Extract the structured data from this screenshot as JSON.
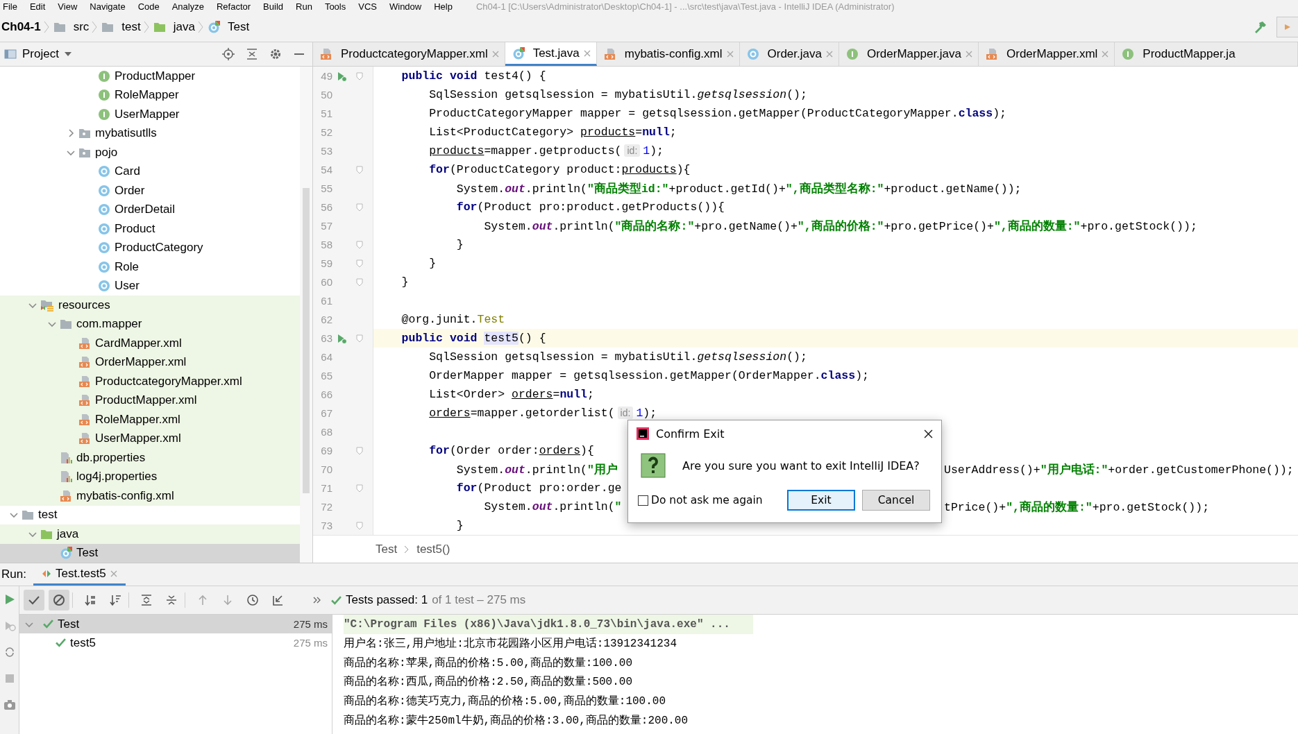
{
  "menu": [
    "File",
    "Edit",
    "View",
    "Navigate",
    "Code",
    "Analyze",
    "Refactor",
    "Build",
    "Run",
    "Tools",
    "VCS",
    "Window",
    "Help"
  ],
  "window_title": "Ch04-1 [C:\\Users\\Administrator\\Desktop\\Ch04-1] - ...\\src\\test\\java\\Test.java - IntelliJ IDEA (Administrator)",
  "breadcrumbs": [
    {
      "label": "Ch04-1",
      "kind": "project"
    },
    {
      "label": "src",
      "kind": "folder"
    },
    {
      "label": "test",
      "kind": "folder"
    },
    {
      "label": "java",
      "kind": "source_folder"
    },
    {
      "label": "Test",
      "kind": "testclass"
    }
  ],
  "project_panel": {
    "title": "Project"
  },
  "tabs": [
    {
      "label": "ProductcategoryMapper.xml",
      "kind": "xml",
      "selected": false,
      "closable": true
    },
    {
      "label": "Test.java",
      "kind": "testclass",
      "selected": true,
      "closable": true
    },
    {
      "label": "mybatis-config.xml",
      "kind": "xml",
      "selected": false,
      "closable": true
    },
    {
      "label": "Order.java",
      "kind": "class",
      "selected": false,
      "closable": true
    },
    {
      "label": "OrderMapper.java",
      "kind": "interface",
      "selected": false,
      "closable": true
    },
    {
      "label": "OrderMapper.xml",
      "kind": "xml",
      "selected": false,
      "closable": true
    },
    {
      "label": "ProductMapper.ja",
      "kind": "interface",
      "selected": false,
      "closable": false
    }
  ],
  "tree": [
    {
      "children": [
        {
          "children": [
            {
              "children": [
                {
                  "children": [
                    {
                      "label": "ProductMapper",
                      "kind": "interface",
                      "selected": false
                    },
                    {
                      "label": "RoleMapper",
                      "kind": "interface",
                      "selected": false
                    },
                    {
                      "label": "UserMapper",
                      "kind": "interface",
                      "selected": false
                    }
                  ]
                },
                {
                  "label": "mybatisutlls",
                  "kind": "package",
                  "expanded": false,
                  "selected": false
                },
                {
                  "label": "pojo",
                  "kind": "package",
                  "expanded": true,
                  "selected": false,
                  "children": [
                    {
                      "label": "Card",
                      "kind": "class",
                      "selected": false
                    },
                    {
                      "label": "Order",
                      "kind": "class",
                      "selected": false
                    },
                    {
                      "label": "OrderDetail",
                      "kind": "class",
                      "selected": false
                    },
                    {
                      "label": "Product",
                      "kind": "class",
                      "selected": false
                    },
                    {
                      "label": "ProductCategory",
                      "kind": "class",
                      "selected": false
                    },
                    {
                      "label": "Role",
                      "kind": "class",
                      "selected": false
                    },
                    {
                      "label": "User",
                      "kind": "class",
                      "selected": false
                    }
                  ]
                }
              ]
            }
          ]
        },
        {
          "label": "resources",
          "kind": "resources_root",
          "expanded": true,
          "selected": false,
          "children": [
            {
              "label": "com.mapper",
              "kind": "folder",
              "expanded": true,
              "selected": false,
              "children": [
                {
                  "label": "CardMapper.xml",
                  "kind": "xml",
                  "selected": false
                },
                {
                  "label": "OrderMapper.xml",
                  "kind": "xml",
                  "selected": false
                },
                {
                  "label": "ProductcategoryMapper.xml",
                  "kind": "xml",
                  "selected": false
                },
                {
                  "label": "ProductMapper.xml",
                  "kind": "xml",
                  "selected": false
                },
                {
                  "label": "RoleMapper.xml",
                  "kind": "xml",
                  "selected": false
                },
                {
                  "label": "UserMapper.xml",
                  "kind": "xml",
                  "selected": false
                }
              ]
            },
            {
              "label": "db.properties",
              "kind": "properties",
              "selected": false
            },
            {
              "label": "log4j.properties",
              "kind": "properties",
              "selected": false
            },
            {
              "label": "mybatis-config.xml",
              "kind": "xml",
              "selected": false
            }
          ]
        }
      ]
    },
    {
      "label": "test",
      "kind": "folder",
      "expanded": true,
      "selected": false,
      "children": [
        {
          "label": "java",
          "kind": "test_root",
          "expanded": true,
          "selected": false,
          "children": [
            {
              "label": "Test",
              "kind": "testclass",
              "selected": true
            }
          ]
        }
      ]
    }
  ],
  "code_lines": [
    {
      "number": "49",
      "kind": "run",
      "current": false,
      "tokens": [
        {
          "text": "    public void",
          "kind": "keyword"
        },
        {
          "text": " test4() {",
          "kind": "plain"
        }
      ]
    },
    {
      "number": "50",
      "kind": "plain",
      "current": false,
      "tokens": [
        {
          "text": "        SqlSession getsqlsession = mybatisUtil.",
          "kind": "plain"
        },
        {
          "text": "getsqlsession",
          "kind": "italic"
        },
        {
          "text": "();",
          "kind": "plain"
        }
      ]
    },
    {
      "number": "51",
      "kind": "plain",
      "current": false,
      "tokens": [
        {
          "text": "        ProductCategoryMapper mapper = getsqlsession.getMapper(ProductCategoryMapper.",
          "kind": "plain"
        },
        {
          "text": "class",
          "kind": "keyword"
        },
        {
          "text": ");",
          "kind": "plain"
        }
      ]
    },
    {
      "number": "52",
      "kind": "plain",
      "current": false,
      "tokens": [
        {
          "text": "        List<ProductCategory> ",
          "kind": "plain"
        },
        {
          "text": "products",
          "kind": "underline"
        },
        {
          "text": "=",
          "kind": "plain"
        },
        {
          "text": "null",
          "kind": "keyword"
        },
        {
          "text": ";",
          "kind": "plain"
        }
      ]
    },
    {
      "number": "53",
      "kind": "plain",
      "current": false,
      "tokens": [
        {
          "text": "        products",
          "kind": "underline"
        },
        {
          "text": "=mapper.getproducts(",
          "kind": "plain"
        },
        {
          "text": "id:",
          "kind": "hint"
        },
        {
          "text": "1",
          "kind": "number"
        },
        {
          "text": ");",
          "kind": "plain"
        }
      ]
    },
    {
      "number": "54",
      "kind": "fold",
      "current": false,
      "tokens": [
        {
          "text": "        for",
          "kind": "keyword"
        },
        {
          "text": "(ProductCategory product:",
          "kind": "plain"
        },
        {
          "text": "products",
          "kind": "underline"
        },
        {
          "text": "){",
          "kind": "plain"
        }
      ]
    },
    {
      "number": "55",
      "kind": "plain",
      "current": false,
      "tokens": [
        {
          "text": "            System.",
          "kind": "plain"
        },
        {
          "text": "out",
          "kind": "field"
        },
        {
          "text": ".println(",
          "kind": "plain"
        },
        {
          "text": "\"商品类型id:\"",
          "kind": "string"
        },
        {
          "text": "+product.getId()+",
          "kind": "plain"
        },
        {
          "text": "\",商品类型名称:\"",
          "kind": "string"
        },
        {
          "text": "+product.getName());",
          "kind": "plain"
        }
      ]
    },
    {
      "number": "56",
      "kind": "fold",
      "current": false,
      "tokens": [
        {
          "text": "            for",
          "kind": "keyword"
        },
        {
          "text": "(Product pro:product.getProducts()){",
          "kind": "plain"
        }
      ]
    },
    {
      "number": "57",
      "kind": "plain",
      "current": false,
      "tokens": [
        {
          "text": "                System.",
          "kind": "plain"
        },
        {
          "text": "out",
          "kind": "field"
        },
        {
          "text": ".println(",
          "kind": "plain"
        },
        {
          "text": "\"商品的名称:\"",
          "kind": "string"
        },
        {
          "text": "+pro.getName()+",
          "kind": "plain"
        },
        {
          "text": "\",商品的价格:\"",
          "kind": "string"
        },
        {
          "text": "+pro.getPrice()+",
          "kind": "plain"
        },
        {
          "text": "\",商品的数量:\"",
          "kind": "string"
        },
        {
          "text": "+pro.getStock());",
          "kind": "plain"
        }
      ]
    },
    {
      "number": "58",
      "kind": "fold",
      "current": false,
      "tokens": [
        {
          "text": "            }",
          "kind": "plain"
        }
      ]
    },
    {
      "number": "59",
      "kind": "fold",
      "current": false,
      "tokens": [
        {
          "text": "        }",
          "kind": "plain"
        }
      ]
    },
    {
      "number": "60",
      "kind": "fold",
      "current": false,
      "tokens": [
        {
          "text": "    }",
          "kind": "plain"
        }
      ]
    },
    {
      "number": "61",
      "kind": "plain",
      "current": false
    },
    {
      "number": "62",
      "kind": "plain",
      "current": false,
      "tokens": [
        {
          "text": "    @org.junit.",
          "kind": "plain"
        },
        {
          "text": "Test",
          "kind": "annotation"
        }
      ]
    },
    {
      "number": "63",
      "kind": "run",
      "current": true,
      "tokens": [
        {
          "text": "    public void ",
          "kind": "keyword"
        },
        {
          "text": "test5",
          "kind": "highlight"
        },
        {
          "text": "() {",
          "kind": "plain"
        }
      ]
    },
    {
      "number": "64",
      "kind": "plain",
      "current": false,
      "tokens": [
        {
          "text": "        SqlSession getsqlsession = mybatisUtil.",
          "kind": "plain"
        },
        {
          "text": "getsqlsession",
          "kind": "italic"
        },
        {
          "text": "();",
          "kind": "plain"
        }
      ]
    },
    {
      "number": "65",
      "kind": "plain",
      "current": false,
      "tokens": [
        {
          "text": "        OrderMapper mapper = getsqlsession.getMapper(OrderMapper.",
          "kind": "plain"
        },
        {
          "text": "class",
          "kind": "keyword"
        },
        {
          "text": ");",
          "kind": "plain"
        }
      ]
    },
    {
      "number": "66",
      "kind": "plain",
      "current": false,
      "tokens": [
        {
          "text": "        List<Order> ",
          "kind": "plain"
        },
        {
          "text": "orders",
          "kind": "underline"
        },
        {
          "text": "=",
          "kind": "plain"
        },
        {
          "text": "null",
          "kind": "keyword"
        },
        {
          "text": ";",
          "kind": "plain"
        }
      ]
    },
    {
      "number": "67",
      "kind": "plain",
      "current": false,
      "tokens": [
        {
          "text": "        orders",
          "kind": "underline"
        },
        {
          "text": "=mapper.getorderlist(",
          "kind": "plain"
        },
        {
          "text": "id:",
          "kind": "hint"
        },
        {
          "text": "1",
          "kind": "number"
        },
        {
          "text": ");",
          "kind": "plain"
        }
      ]
    },
    {
      "number": "68",
      "kind": "plain",
      "current": false
    },
    {
      "number": "69",
      "kind": "fold",
      "current": false,
      "tokens": [
        {
          "text": "        for",
          "kind": "keyword"
        },
        {
          "text": "(Order order:",
          "kind": "plain"
        },
        {
          "text": "orders",
          "kind": "underline"
        },
        {
          "text": "){",
          "kind": "plain"
        }
      ]
    },
    {
      "number": "70",
      "kind": "plain",
      "current": false,
      "tokens": [
        {
          "text": "            System.",
          "kind": "plain"
        },
        {
          "text": "out",
          "kind": "field"
        },
        {
          "text": ".println(",
          "kind": "plain"
        },
        {
          "text": "\"用户",
          "kind": "string"
        }
      ],
      "tokens_after_dialog": [
        {
          "text": "UserAddress()+",
          "kind": "plain"
        },
        {
          "text": "\"用户电话:\"",
          "kind": "string"
        },
        {
          "text": "+order.getCustomerPhone());",
          "kind": "plain"
        }
      ]
    },
    {
      "number": "71",
      "kind": "fold",
      "current": false,
      "tokens": [
        {
          "text": "            for",
          "kind": "keyword"
        },
        {
          "text": "(Product pro:order.ge",
          "kind": "plain"
        }
      ]
    },
    {
      "number": "72",
      "kind": "plain",
      "current": false,
      "tokens": [
        {
          "text": "                System.",
          "kind": "plain"
        },
        {
          "text": "out",
          "kind": "field"
        },
        {
          "text": ".println(",
          "kind": "plain"
        },
        {
          "text": "\"",
          "kind": "string"
        }
      ],
      "tokens_after_dialog": [
        {
          "text": "tPrice()+",
          "kind": "plain"
        },
        {
          "text": "\",商品的数量:\"",
          "kind": "string"
        },
        {
          "text": "+pro.getStock());",
          "kind": "plain"
        }
      ]
    },
    {
      "number": "73",
      "kind": "fold",
      "current": false,
      "tokens": [
        {
          "text": "            }",
          "kind": "plain"
        }
      ]
    }
  ],
  "editor_breadcrumbs": [
    "Test",
    "test5()"
  ],
  "run_panel": {
    "label": "Run:",
    "tab": "Test.test5",
    "status": {
      "passed": "Tests passed: 1",
      "detail": "of 1 test – 275 ms"
    },
    "tests": [
      {
        "name": "Test",
        "time": "275 ms",
        "selected": true,
        "children": [
          {
            "name": "test5",
            "time": "275 ms",
            "selected": false
          }
        ]
      }
    ],
    "console": [
      {
        "text": "\"C:\\Program Files (x86)\\Java\\jdk1.8.0_73\\bin\\java.exe\" ...",
        "kind": "command"
      },
      {
        "text": "用户名:张三,用户地址:北京市花园路小区用户电话:13912341234",
        "kind": "output"
      },
      {
        "text": "商品的名称:苹果,商品的价格:5.00,商品的数量:100.00",
        "kind": "output"
      },
      {
        "text": "商品的名称:西瓜,商品的价格:2.50,商品的数量:500.00",
        "kind": "output"
      },
      {
        "text": "商品的名称:德芙巧克力,商品的价格:5.00,商品的数量:100.00",
        "kind": "output"
      },
      {
        "text": "商品的名称:蒙牛250ml牛奶,商品的价格:3.00,商品的数量:200.00",
        "kind": "output"
      }
    ]
  },
  "dialog": {
    "title": "Confirm Exit",
    "message": "Are you sure you want to exit IntelliJ IDEA?",
    "checkbox": {
      "label": "Do not ask me again",
      "checked": false
    },
    "buttons": [
      {
        "label": "Exit",
        "selected": true
      },
      {
        "label": "Cancel",
        "selected": false
      }
    ]
  }
}
